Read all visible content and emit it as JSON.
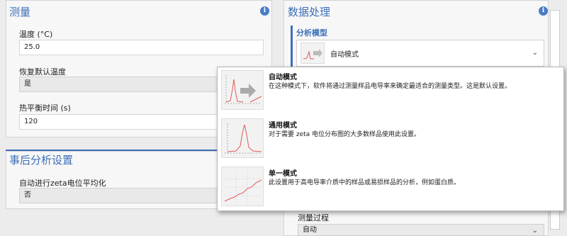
{
  "measurement": {
    "title": "测量",
    "temperature_label": "温度 (°C)",
    "temperature_value": "25.0",
    "restore_label": "恢复默认温度",
    "restore_value": "是",
    "equilibration_label": "热平衡时间 (s)",
    "equilibration_value": "120"
  },
  "post_analysis": {
    "title": "事后分析设置",
    "auto_average_label": "自动进行zeta电位平均化",
    "auto_average_value": "否"
  },
  "data_processing": {
    "title": "数据处理",
    "analysis_model_label": "分析模型",
    "analysis_model_value": "自动模式",
    "measurement_process_label": "测量过程",
    "measurement_process_value": "自动"
  },
  "popup": {
    "options": [
      {
        "title": "自动模式",
        "description": "在这种模式下，软件将通过测量样品电导率来确定最适合的测量类型。这是默认设置。",
        "icon": "auto-mode-chart-icon"
      },
      {
        "title": "通用模式",
        "description": "对于需要 zeta 电位分布图的大多数样品使用此设置。",
        "icon": "general-mode-chart-icon"
      },
      {
        "title": "单一模式",
        "description": "此设置用于高电导率介质中的样品或易损样品的分析，例如蛋白质。",
        "icon": "monomodal-chart-icon"
      }
    ]
  },
  "colors": {
    "accent": "#3d6fb8",
    "curve": "#e05a5a"
  }
}
